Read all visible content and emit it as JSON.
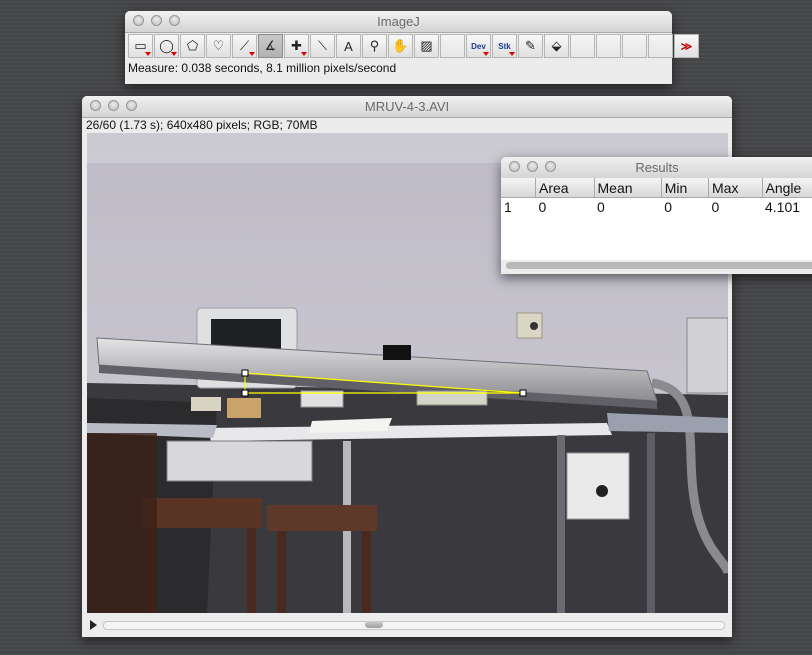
{
  "imagej": {
    "title": "ImageJ",
    "tools": [
      {
        "name": "rectangle-tool-button",
        "icon": "rectangle-icon",
        "glyph": "▭",
        "menu": true
      },
      {
        "name": "oval-tool-button",
        "icon": "oval-icon",
        "glyph": "◯",
        "menu": true
      },
      {
        "name": "polygon-tool-button",
        "icon": "polygon-icon",
        "glyph": "⬠",
        "menu": false
      },
      {
        "name": "freehand-tool-button",
        "icon": "freehand-icon",
        "glyph": "♡",
        "menu": false
      },
      {
        "name": "line-tool-button",
        "icon": "line-icon",
        "glyph": "⟋",
        "menu": true
      },
      {
        "name": "angle-tool-button",
        "icon": "angle-icon",
        "glyph": "∡",
        "menu": false,
        "selected": true
      },
      {
        "name": "point-tool-button",
        "icon": "point-icon",
        "glyph": "✚",
        "menu": true
      },
      {
        "name": "wand-tool-button",
        "icon": "wand-icon",
        "glyph": "⟍",
        "menu": false
      },
      {
        "name": "text-tool-button",
        "icon": "text-icon",
        "glyph": "A",
        "menu": false
      },
      {
        "name": "magnifier-tool-button",
        "icon": "magnifier-icon",
        "glyph": "⚲",
        "menu": false
      },
      {
        "name": "hand-tool-button",
        "icon": "hand-icon",
        "glyph": "✋",
        "menu": false
      },
      {
        "name": "color-picker-tool-button",
        "icon": "color-picker-icon",
        "glyph": "▨",
        "menu": false
      },
      {
        "name": "empty-slot-1",
        "icon": "",
        "glyph": "",
        "menu": false,
        "blank": true
      },
      {
        "name": "dev-menu-button",
        "icon": "",
        "glyph": "Dev",
        "menu": true,
        "txt": true
      },
      {
        "name": "stk-menu-button",
        "icon": "",
        "glyph": "Stk",
        "menu": true,
        "txt": true
      },
      {
        "name": "brush-tool-button",
        "icon": "brush-icon",
        "glyph": "✎",
        "menu": false
      },
      {
        "name": "flood-fill-tool-button",
        "icon": "flood-fill-icon",
        "glyph": "⬙",
        "menu": false
      },
      {
        "name": "empty-slot-2",
        "icon": "",
        "glyph": "",
        "menu": false,
        "blank": true
      },
      {
        "name": "empty-slot-3",
        "icon": "",
        "glyph": "",
        "menu": false,
        "blank": true
      },
      {
        "name": "empty-slot-4",
        "icon": "",
        "glyph": "",
        "menu": false,
        "blank": true
      },
      {
        "name": "empty-slot-5",
        "icon": "",
        "glyph": "",
        "menu": false,
        "blank": true
      },
      {
        "name": "more-tools-button",
        "icon": "double-chevron-right-icon",
        "glyph": "≫",
        "menu": false,
        "red": true
      }
    ],
    "status": "Measure: 0.038 seconds, 8.1 million pixels/second"
  },
  "movie": {
    "title": "MRUV-4-3.AVI",
    "info": "26/60 (1.73 s); 640x480 pixels; RGB; 70MB",
    "frame_fraction": 0.433
  },
  "results": {
    "title": "Results",
    "headers": [
      "",
      "Area",
      "Mean",
      "Min",
      "Max",
      "Angle"
    ],
    "rows": [
      [
        "1",
        "0",
        "0",
        "0",
        "0",
        "4.101"
      ]
    ]
  },
  "colors": {
    "selection": "#ffff00",
    "handle": "#ffffff"
  }
}
